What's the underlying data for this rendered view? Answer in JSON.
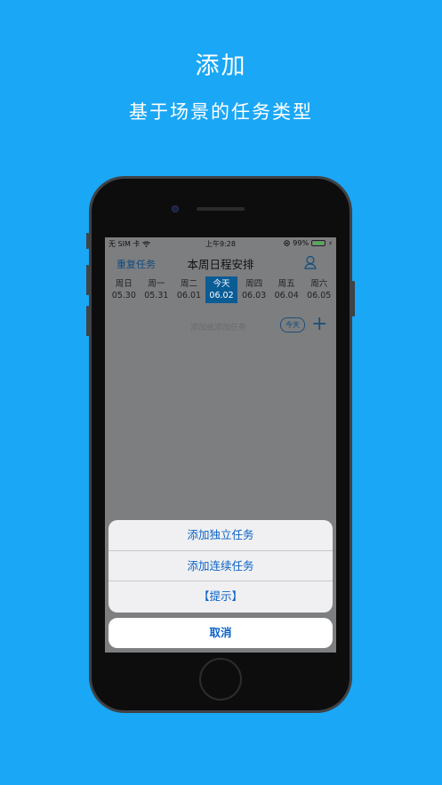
{
  "hero": {
    "title": "添加",
    "subtitle": "基于场景的任务类型"
  },
  "statusbar": {
    "carrier": "无 SIM 卡",
    "time": "上午9:28",
    "battery": "99%",
    "battery_level": 0.99
  },
  "navbar": {
    "left_label": "重复任务",
    "title": "本周日程安排",
    "right_icon": "user-icon"
  },
  "week": [
    {
      "weekday": "周日",
      "date": "05.30",
      "today": false
    },
    {
      "weekday": "周一",
      "date": "05.31",
      "today": false
    },
    {
      "weekday": "周二",
      "date": "06.01",
      "today": false
    },
    {
      "weekday": "今天",
      "date": "06.02",
      "today": true
    },
    {
      "weekday": "周四",
      "date": "06.03",
      "today": false
    },
    {
      "weekday": "周五",
      "date": "06.04",
      "today": false
    },
    {
      "weekday": "周六",
      "date": "06.05",
      "today": false
    }
  ],
  "addrow": {
    "hint": "添加或添加任务",
    "today_label": "今天"
  },
  "action_sheet": {
    "items": [
      "添加独立任务",
      "添加连续任务",
      "【提示】"
    ],
    "cancel": "取消"
  },
  "colors": {
    "background": "#1aa7f5",
    "accent": "#0a63c9",
    "today": "#0a5c95"
  }
}
